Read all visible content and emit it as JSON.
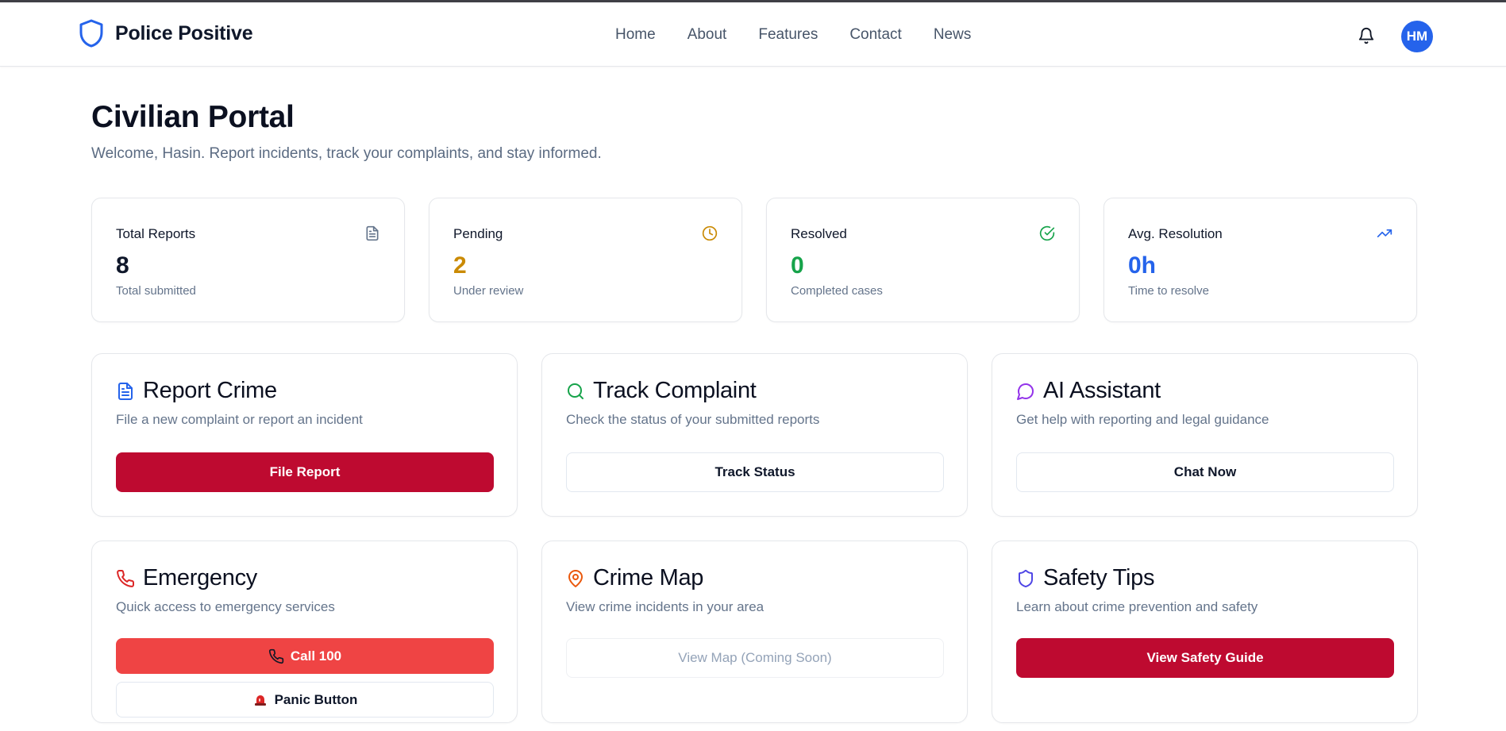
{
  "header": {
    "brand": "Police Positive",
    "nav": [
      "Home",
      "About",
      "Features",
      "Contact",
      "News"
    ],
    "avatar_initials": "HM"
  },
  "page": {
    "title": "Civilian Portal",
    "subtitle": "Welcome, Hasin. Report incidents, track your complaints, and stay informed."
  },
  "stats": [
    {
      "label": "Total Reports",
      "value": "8",
      "caption": "Total submitted",
      "icon": "file-text-icon",
      "color": "#0f172a"
    },
    {
      "label": "Pending",
      "value": "2",
      "caption": "Under review",
      "icon": "clock-icon",
      "color": "#ca8a04"
    },
    {
      "label": "Resolved",
      "value": "0",
      "caption": "Completed cases",
      "icon": "check-circle-icon",
      "color": "#16a34a"
    },
    {
      "label": "Avg. Resolution",
      "value": "0h",
      "caption": "Time to resolve",
      "icon": "trending-up-icon",
      "color": "#2563eb"
    }
  ],
  "features": {
    "report": {
      "title": "Report Crime",
      "desc": "File a new complaint or report an incident",
      "button": "File Report",
      "icon": "file-text-icon",
      "color": "#2563eb"
    },
    "track": {
      "title": "Track Complaint",
      "desc": "Check the status of your submitted reports",
      "button": "Track Status",
      "icon": "search-icon",
      "color": "#16a34a"
    },
    "ai": {
      "title": "AI Assistant",
      "desc": "Get help with reporting and legal guidance",
      "button": "Chat Now",
      "icon": "message-circle-icon",
      "color": "#9333ea"
    },
    "emergency": {
      "title": "Emergency",
      "desc": "Quick access to emergency services",
      "button_call": "Call 100",
      "button_panic": "Panic Button",
      "icon": "phone-icon",
      "color": "#dc2626"
    },
    "map": {
      "title": "Crime Map",
      "desc": "View crime incidents in your area",
      "button": "View Map (Coming Soon)",
      "icon": "map-pin-icon",
      "color": "#ea580c"
    },
    "safety": {
      "title": "Safety Tips",
      "desc": "Learn about crime prevention and safety",
      "button": "View Safety Guide",
      "icon": "shield-icon",
      "color": "#4f46e5"
    }
  },
  "colors": {
    "primary": "#be0a30",
    "danger": "#ef4444",
    "brand_blue": "#2563eb"
  }
}
